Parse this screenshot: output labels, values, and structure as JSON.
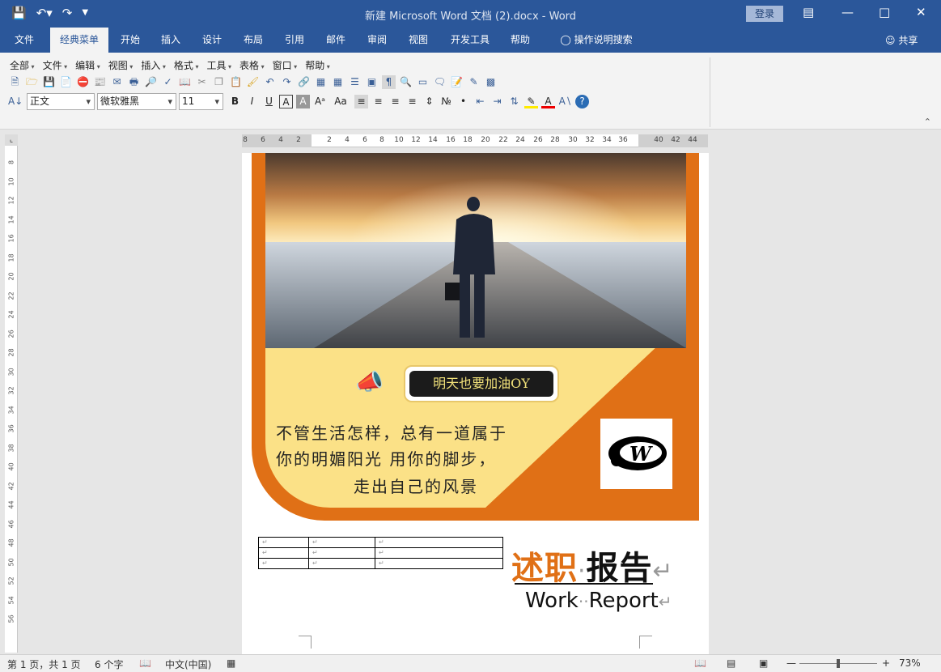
{
  "window": {
    "title": "新建 Microsoft Word 文档 (2).docx  -  Word",
    "login_label": "登录",
    "share_label": "共享"
  },
  "tabs": [
    {
      "label": "文件"
    },
    {
      "label": "经典菜单",
      "active": true
    },
    {
      "label": "开始"
    },
    {
      "label": "插入"
    },
    {
      "label": "设计"
    },
    {
      "label": "布局"
    },
    {
      "label": "引用"
    },
    {
      "label": "邮件"
    },
    {
      "label": "审阅"
    },
    {
      "label": "视图"
    },
    {
      "label": "开发工具"
    },
    {
      "label": "帮助"
    },
    {
      "label": "操作说明搜索"
    }
  ],
  "classic_menu": [
    "全部",
    "文件",
    "编辑",
    "视图",
    "插入",
    "格式",
    "工具",
    "表格",
    "窗口",
    "帮助"
  ],
  "format_bar": {
    "style": "正文",
    "font": "微软雅黑",
    "size": "11"
  },
  "ruler": {
    "horizontal_numbers": [
      "8",
      "6",
      "4",
      "2",
      "2",
      "4",
      "6",
      "8",
      "10",
      "12",
      "14",
      "16",
      "18",
      "20",
      "22",
      "24",
      "26",
      "28",
      "30",
      "32",
      "34",
      "36",
      "40",
      "42",
      "44"
    ],
    "vertical_numbers": [
      "8",
      "10",
      "12",
      "14",
      "16",
      "18",
      "20",
      "22",
      "24",
      "26",
      "28",
      "30",
      "32",
      "34",
      "36",
      "38",
      "40",
      "42",
      "44",
      "46",
      "48",
      "50",
      "52",
      "54",
      "56"
    ]
  },
  "document": {
    "slogan": "明天也要加油OY",
    "handwriting_lines": [
      "不管生活怎样，总有一道属于",
      "你的明媚阳光  用你的脚步，",
      "走出自己的风景"
    ],
    "table_mark": "↵",
    "title_cn_orange": "述职",
    "title_cn_black": "报告",
    "title_en_a": "Work",
    "title_en_b": "Report",
    "para_mark": "↵"
  },
  "status": {
    "page": "第 1 页，共 1 页",
    "words": "6 个字",
    "language": "中文(中国)",
    "zoom": "73%",
    "zoom_fraction": 0.5
  },
  "colors": {
    "title_bar": "#2b579a",
    "orange": "#e07016",
    "yellow": "#fbe187"
  }
}
